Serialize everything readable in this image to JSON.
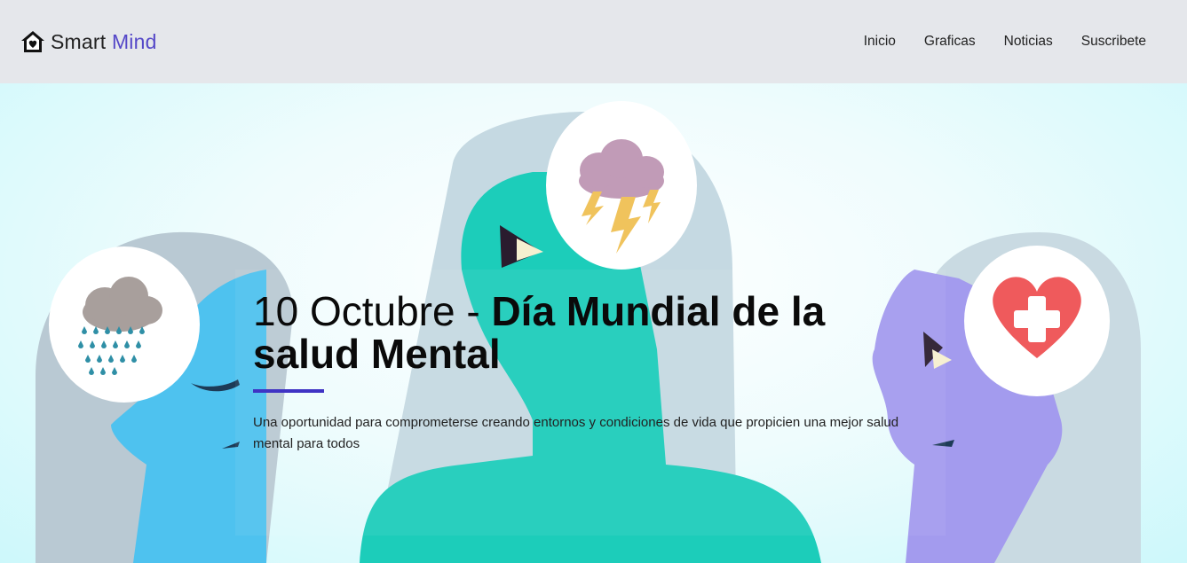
{
  "brand": {
    "name_part1": "Smart",
    "name_part2": "Mind",
    "icon": "house-heart-icon",
    "accent_color": "#5548c8"
  },
  "nav": {
    "items": [
      {
        "label": "Inicio"
      },
      {
        "label": "Graficas"
      },
      {
        "label": "Noticias"
      },
      {
        "label": "Suscribete"
      }
    ]
  },
  "hero": {
    "title_normal": "10 Octubre - ",
    "title_bold_line1": "Día Mundial de la",
    "title_bold_line2": "salud Mental",
    "description": "Una oportunidad para comprometerse creando entornos y condiciones de vida que propicien una mejor salud mental para todos",
    "divider_color": "#3f33c4",
    "illustration": [
      "rain-cloud-icon",
      "storm-cloud-icon",
      "heart-cross-icon"
    ]
  }
}
